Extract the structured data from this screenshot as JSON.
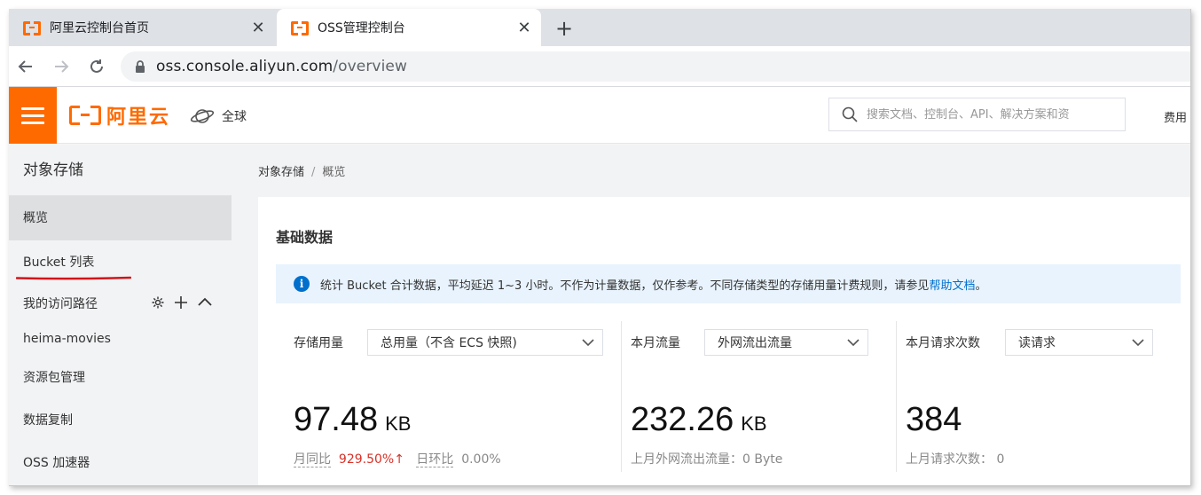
{
  "browser": {
    "tabs": [
      {
        "title": "阿里云控制台首页",
        "close": "✕"
      },
      {
        "title": "OSS管理控制台",
        "close": "✕"
      }
    ],
    "new_tab": "+",
    "url_host": "oss.console.aliyun.com",
    "url_path": "/overview"
  },
  "header": {
    "brand": "阿里云",
    "region": "全球",
    "search_placeholder": "搜索文档、控制台、API、解决方案和资",
    "fee": "费用",
    "accent": "#ff6a00"
  },
  "sidebar": {
    "title": "对象存储",
    "items": [
      "概览",
      "Bucket 列表"
    ],
    "group_label": "我的访问路径",
    "group_items": [
      "heima-movies"
    ],
    "bottom_items": [
      "资源包管理",
      "数据复制",
      "OSS 加速器"
    ]
  },
  "breadcrumb": {
    "root": "对象存储",
    "separator": "/",
    "current": "概览"
  },
  "card": {
    "title": "基础数据",
    "notice_text": "统计 Bucket 合计数据，平均延迟 1~3 小时。不作为计量数据，仅作参考。不同存储类型的存储用量计费规则，请参见",
    "notice_link": "帮助文档",
    "notice_end": "。"
  },
  "metrics": {
    "storage": {
      "label": "存储用量",
      "select": "总用量（不含 ECS 快照)",
      "value": "97.48",
      "unit": "KB",
      "yoy_label": "月同比",
      "yoy_value": "929.50%",
      "yoy_arrow": "↑",
      "mom_label": "日环比",
      "mom_value": "0.00%"
    },
    "traffic": {
      "label": "本月流量",
      "select": "外网流出流量",
      "value": "232.26",
      "unit": "KB",
      "last_label": "上月外网流出流量：",
      "last_value": "0 Byte"
    },
    "requests": {
      "label": "本月请求次数",
      "select": "读请求",
      "value": "384",
      "last_label": "上月请求次数：",
      "last_value": "0"
    }
  }
}
